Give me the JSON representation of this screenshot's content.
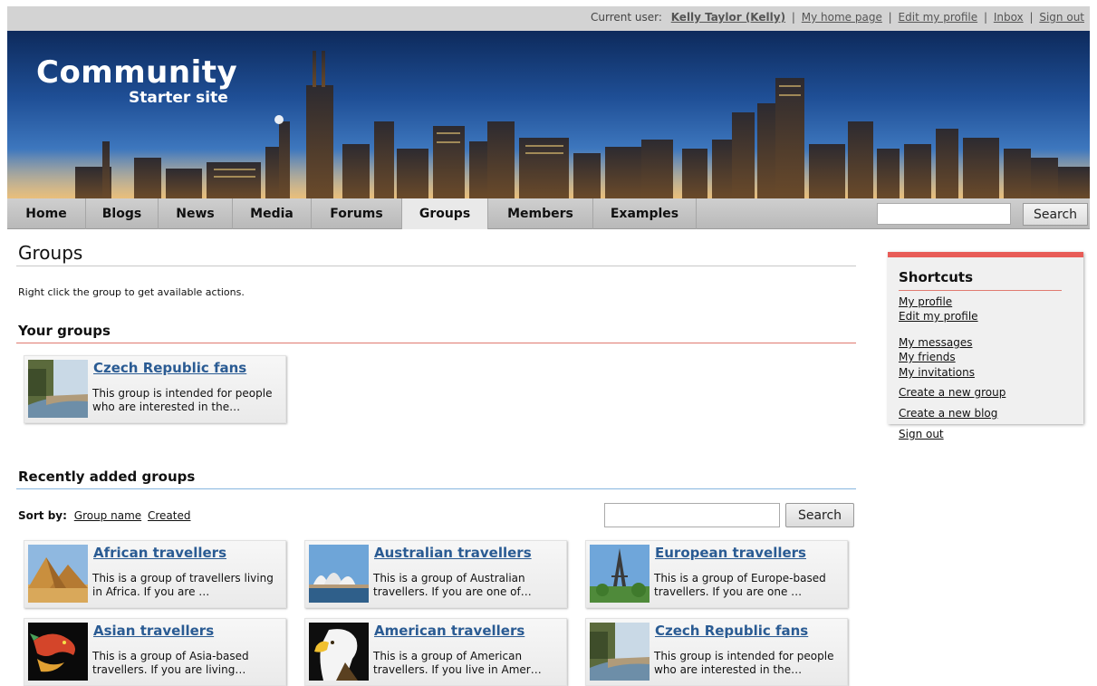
{
  "topbar": {
    "current_user_label": "Current user:",
    "user_name": "Kelly Taylor (Kelly)",
    "links": [
      "My home page",
      "Edit my profile",
      "Inbox",
      "Sign out"
    ]
  },
  "logo": {
    "main": "Community",
    "sub": "Starter site"
  },
  "nav": {
    "items": [
      "Home",
      "Blogs",
      "News",
      "Media",
      "Forums",
      "Groups",
      "Members",
      "Examples"
    ],
    "active": "Groups",
    "search_button": "Search"
  },
  "main": {
    "title": "Groups",
    "intro": "Right click the group to get available actions.",
    "your_groups_heading": "Your groups",
    "your_groups": [
      {
        "title": "Czech Republic fans",
        "desc": "This group is intended for people who are interested in the…",
        "thumb": "riverside-photo"
      }
    ],
    "recent_heading": "Recently added groups",
    "sort_label": "Sort by:",
    "sort_options": [
      "Group name",
      "Created"
    ],
    "search_button": "Search",
    "recent_groups": [
      {
        "title": "African travellers",
        "desc": "This is a group of travellers living in Africa. If you are …",
        "thumb": "pyramids-photo"
      },
      {
        "title": "Australian travellers",
        "desc": "This is a group of Australian travellers. If you are one of…",
        "thumb": "opera-house-photo"
      },
      {
        "title": "European travellers",
        "desc": "This is a group of Europe-based travellers. If you are one …",
        "thumb": "eiffel-tower-photo"
      },
      {
        "title": "Asian travellers",
        "desc": "This is a group of Asia-based travellers. If you are living…",
        "thumb": "dragon-photo"
      },
      {
        "title": "American travellers",
        "desc": "This is a group of American travellers. If you live in Amer…",
        "thumb": "eagle-photo"
      },
      {
        "title": "Czech Republic fans",
        "desc": "This group is intended for people who are interested in the…",
        "thumb": "riverside-photo"
      }
    ]
  },
  "shortcuts": {
    "heading": "Shortcuts",
    "links": [
      "My profile",
      "Edit my profile",
      "My messages",
      "My friends",
      "My invitations",
      "Create a new group",
      "Create a new blog",
      "Sign out"
    ]
  },
  "colors": {
    "accent_red": "#e85c57",
    "link_blue": "#2a5b93",
    "nav_gray": "#c4c4c4"
  }
}
